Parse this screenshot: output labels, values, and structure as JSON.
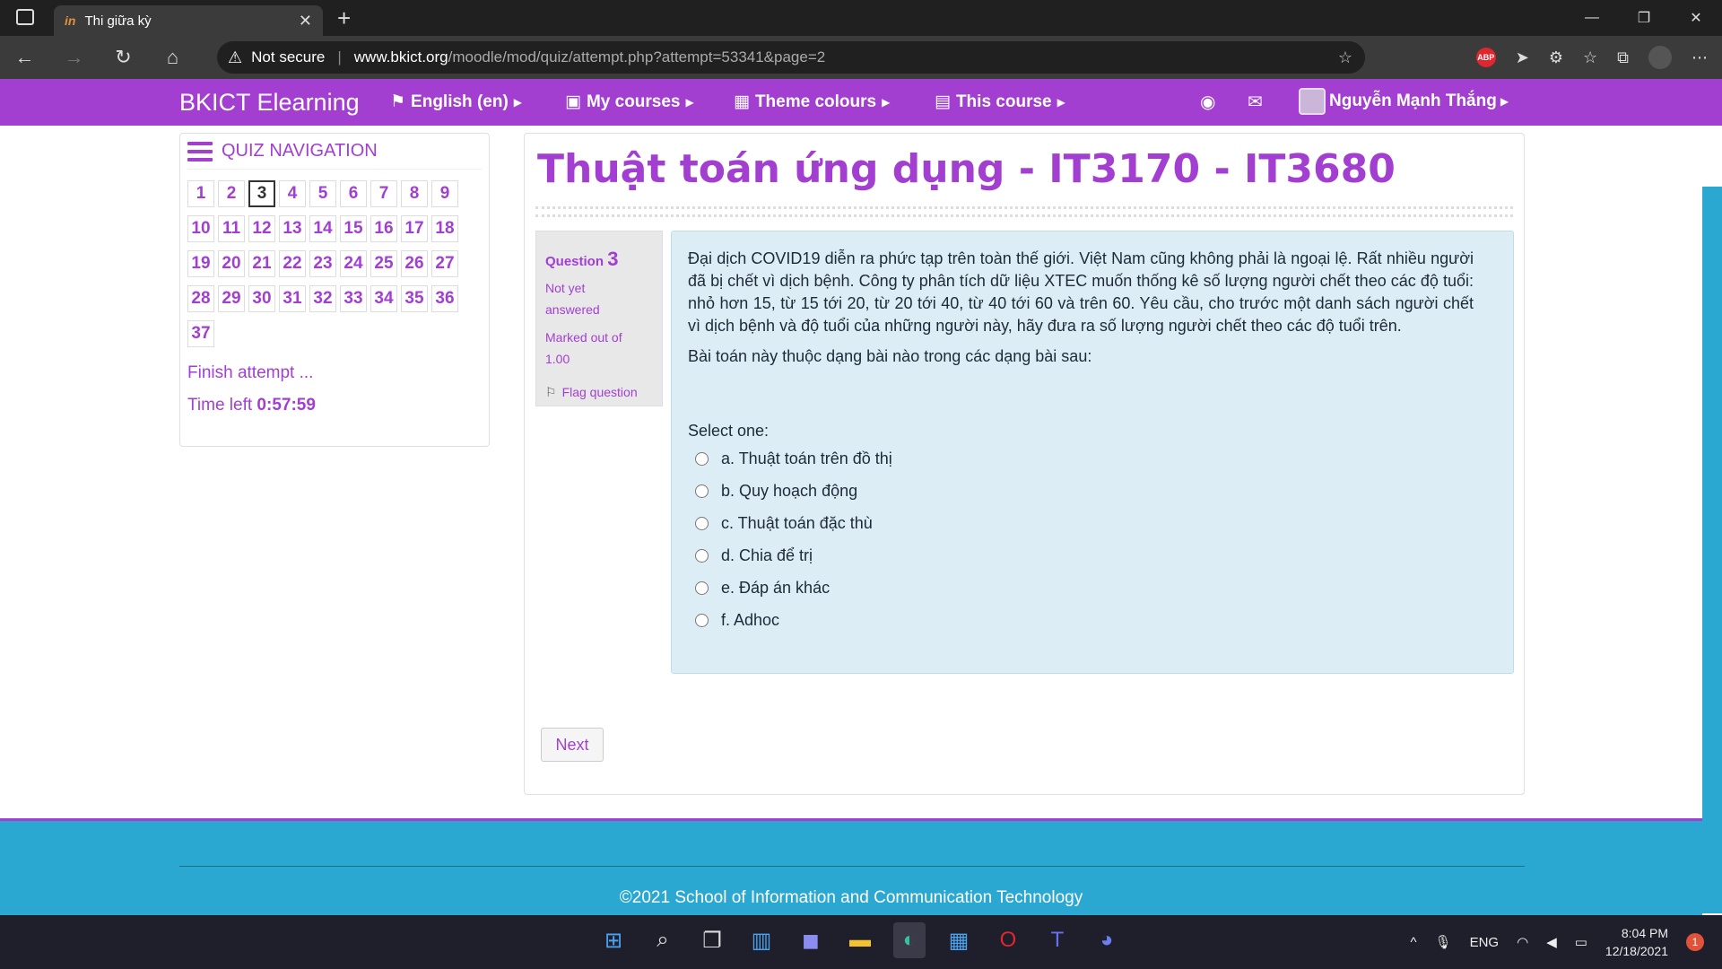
{
  "browser": {
    "tab_title": "Thi giữa kỳ",
    "tab_favicon": "in",
    "security_label": "Not secure",
    "url_host": "www.bkict.org",
    "url_path": "/moodle/mod/quiz/attempt.php?attempt=53341&page=2",
    "abp_label": "ABP"
  },
  "navbar": {
    "brand": "BKICT Elearning",
    "language": "English (en)",
    "my_courses": "My courses",
    "theme_colours": "Theme colours",
    "this_course": "This course",
    "user_name": "Nguyễn Mạnh Thắng"
  },
  "quiz_nav": {
    "heading": "QUIZ NAVIGATION",
    "questions": [
      "1",
      "2",
      "3",
      "4",
      "5",
      "6",
      "7",
      "8",
      "9",
      "10",
      "11",
      "12",
      "13",
      "14",
      "15",
      "16",
      "17",
      "18",
      "19",
      "20",
      "21",
      "22",
      "23",
      "24",
      "25",
      "26",
      "27",
      "28",
      "29",
      "30",
      "31",
      "32",
      "33",
      "34",
      "35",
      "36",
      "37"
    ],
    "current": "3",
    "finish": "Finish attempt ...",
    "time_label": "Time left",
    "time_value": "0:57:59"
  },
  "main": {
    "course_title": "Thuật toán ứng dụng - IT3170 - IT3680",
    "question_label": "Question",
    "question_number": "3",
    "status_line1": "Not yet",
    "status_line2": "answered",
    "marked_line1": "Marked out of",
    "marked_line2": "1.00",
    "flag": "Flag question",
    "question_text": "Đại dịch COVID19 diễn ra phức tạp trên toàn thế giới. Việt Nam cũng không phải là ngoại lệ. Rất nhiều người đã bị chết vì dịch bệnh. Công ty phân tích dữ liệu XTEC muốn thống kê số lượng người chết theo các độ tuổi: nhỏ hơn 15, từ 15 tới 20, từ 20 tới 40, từ 40 tới 60 và trên 60. Yêu cầu, cho trước một danh sách người chết vì dịch bệnh và độ tuổi của những người này, hãy đưa ra số lượng người chết theo các độ tuổi trên.",
    "question_ask": "Bài toán này thuộc dạng bài nào trong các dạng bài sau:",
    "select_one": "Select one:",
    "options": [
      "a. Thuật toán trên đồ thị",
      "b. Quy hoạch động",
      "c. Thuật toán đặc thù",
      "d. Chia để trị",
      "e. Đáp án khác",
      "f. Adhoc"
    ],
    "next": "Next"
  },
  "footer": {
    "copyright": "©2021 School of Information and Communication Technology"
  },
  "taskbar": {
    "language": "ENG",
    "time": "8:04 PM",
    "date": "12/18/2021",
    "notifications": "1"
  },
  "colors": {
    "accent": "#a23fd1",
    "footer": "#2aa8d1",
    "question_bg": "#dcedf5"
  }
}
